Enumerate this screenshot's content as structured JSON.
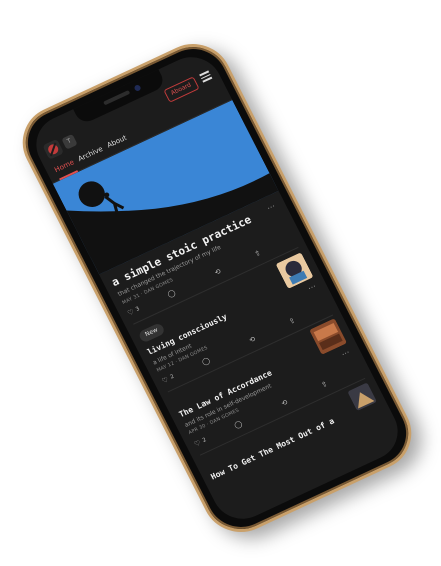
{
  "header": {
    "subscribe_label": "Aboard",
    "tab_chip": "T"
  },
  "nav": {
    "tabs": [
      {
        "label": "Home"
      },
      {
        "label": "Archive"
      },
      {
        "label": "About"
      }
    ]
  },
  "posts": [
    {
      "title": "a simple stoic practice",
      "subtitle": "that changed the trajectory of my life",
      "meta": "MAY 31 · DAN GOMES",
      "likes": "3"
    },
    {
      "badge": "New",
      "title": "living consciously",
      "subtitle": "a life of intent",
      "meta": "MAY 12 · DAN GOMES",
      "likes": "2"
    },
    {
      "title": "The Law of Accordance",
      "subtitle": "and its role in self-development",
      "meta": "APR 30 · DAN GOMES",
      "likes": "2"
    },
    {
      "title": "How To Get The Most Out of a"
    }
  ],
  "colors": {
    "accent": "#e05050",
    "hero_sky": "#3a86d6",
    "frame": "#c9a06a"
  }
}
